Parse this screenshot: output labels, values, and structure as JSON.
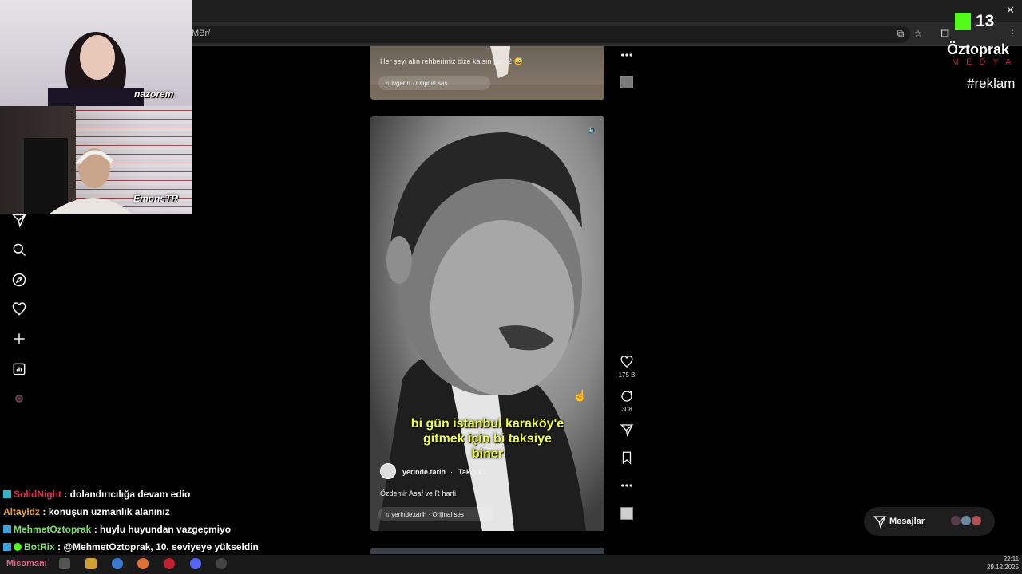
{
  "browser": {
    "url_fragment": "MBr/"
  },
  "overlay": {
    "kick_count": "13",
    "brand": "Öztoprak",
    "brand_sub": "MEDYA",
    "hashtag": "#reklam",
    "cam_names": [
      "nazorem",
      "EmonsTR"
    ]
  },
  "reel_top": {
    "caption": "Her şeyi alın rehberimiz bize kalsın part 2 😅",
    "audio": "ivgenn · Orijinal ses"
  },
  "reel_main": {
    "overlay_text": [
      "bi gün istanbul karaköy'e",
      "gitmek için bi taksiye",
      "biner"
    ],
    "author": "yerinde.tarih",
    "follow_label": "Takip Et",
    "description": "Özdemir Asaf ve R harfi",
    "audio": "yerinde.tarih · Orijinal ses",
    "likes": "175 B",
    "comments": "308"
  },
  "messages": {
    "label": "Mesajlar"
  },
  "chat": [
    {
      "user": "SolidNight",
      "text": ": dolandırıcılığa devam edio",
      "color": "#e0304a"
    },
    {
      "user": "Altayldz",
      "text": ": konuşun uzmanlık alanınız",
      "color": "#e8a23a"
    },
    {
      "user": "MehmetOztoprak",
      "text": ": huylu huyundan vazgeçmiyo",
      "color": "#7ee06a"
    },
    {
      "user": "BotRix",
      "text": ": @MehmetOztoprak, 10. seviyeye yükseldin",
      "color": "#7ee06a"
    }
  ],
  "taskbar": {
    "pinned_label": "Misomani",
    "time": "22:11",
    "date": "29.12.2025"
  }
}
